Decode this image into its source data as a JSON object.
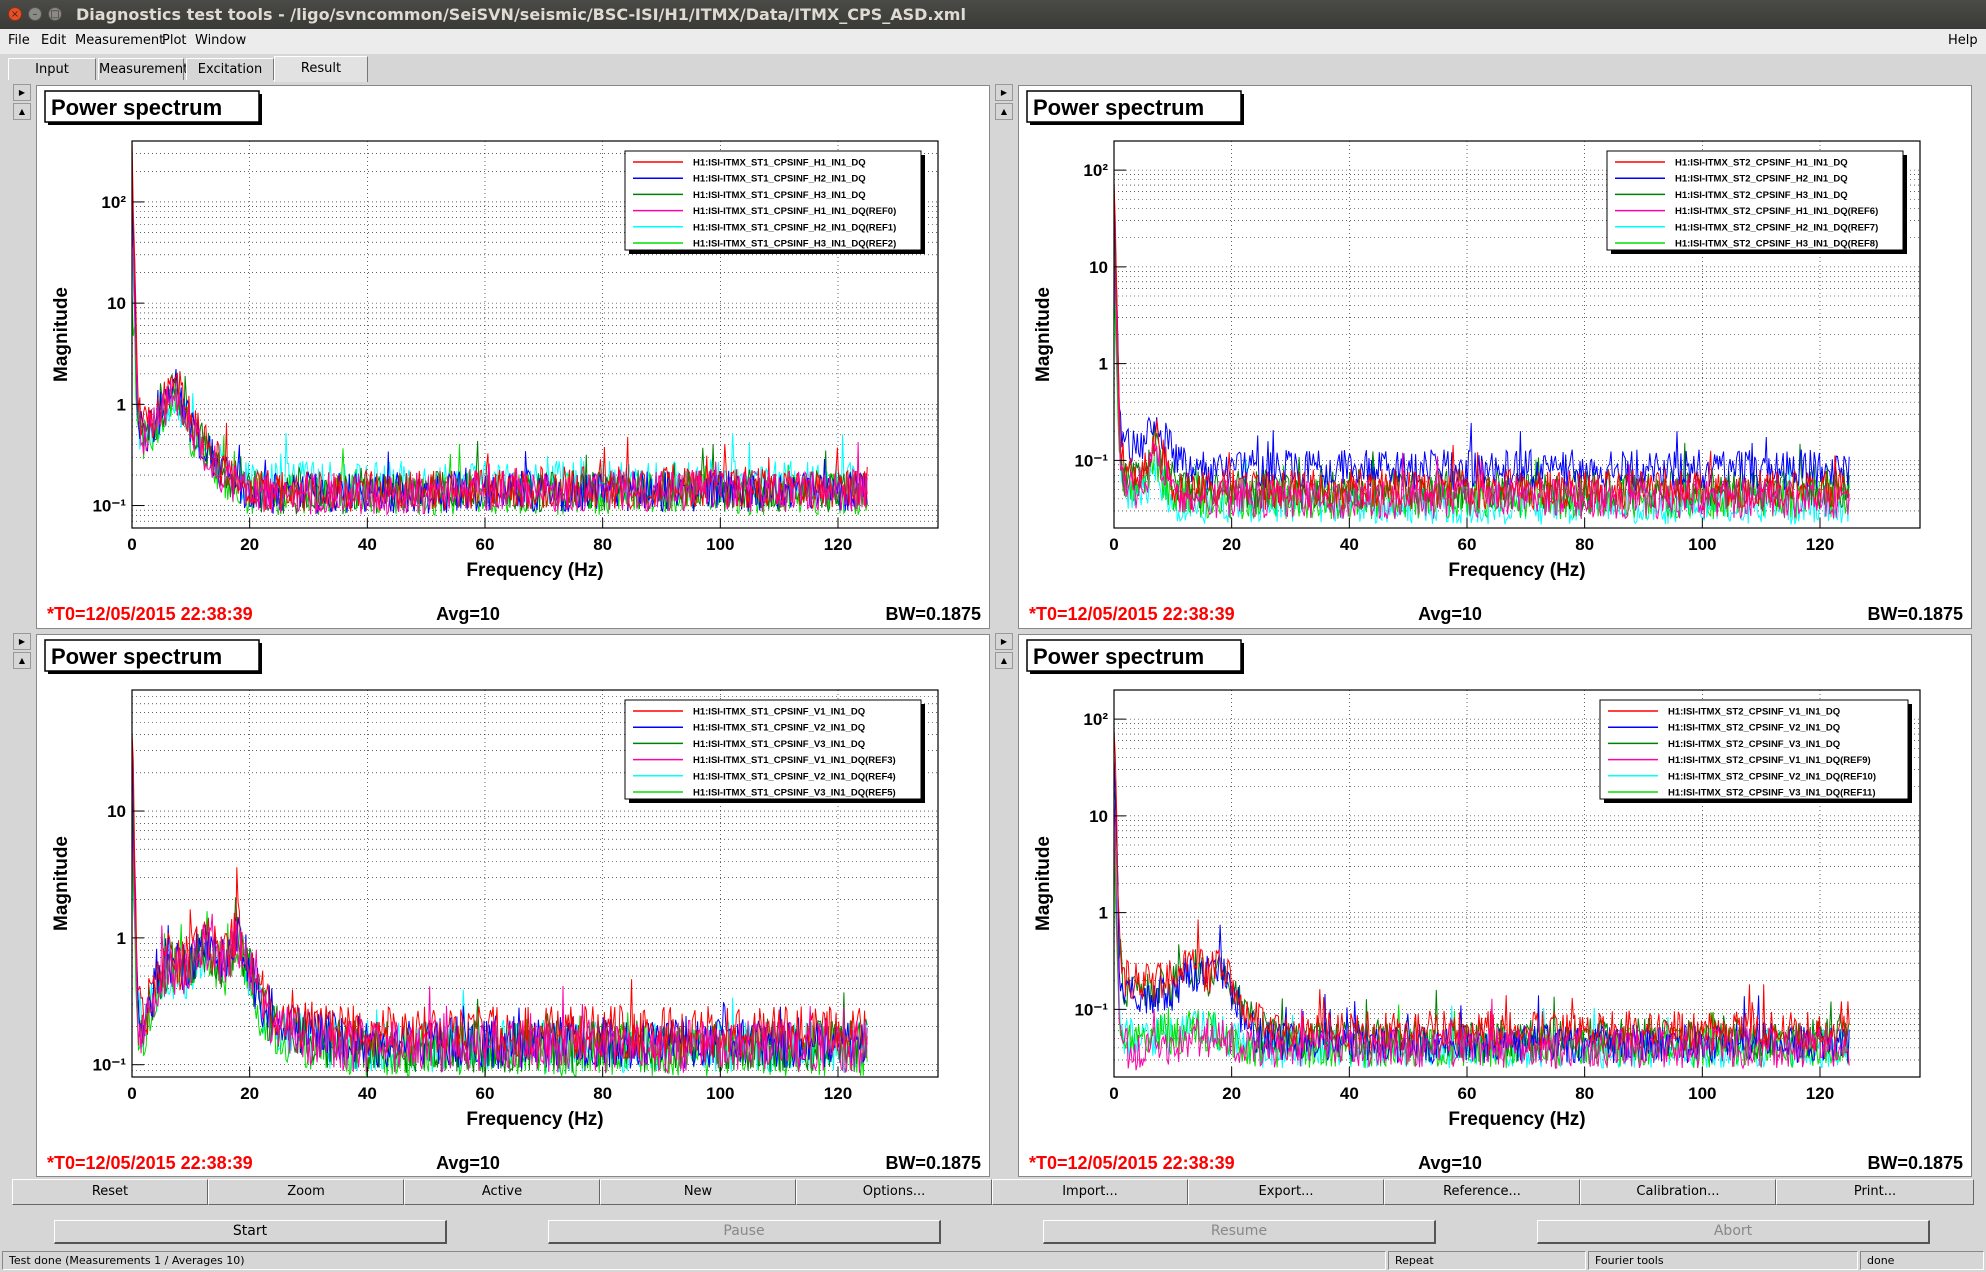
{
  "window": {
    "title": "Diagnostics test tools - /ligo/svncommon/SeiSVN/seismic/BSC-ISI/H1/ITMX/Data/ITMX_CPS_ASD.xml"
  },
  "menu": {
    "items": [
      "File",
      "Edit",
      "Measurement",
      "Plot",
      "Window"
    ],
    "help": "Help"
  },
  "tabs": [
    {
      "label": "Input",
      "active": false
    },
    {
      "label": "Measurement",
      "active": false
    },
    {
      "label": "Excitation",
      "active": false
    },
    {
      "label": "Result",
      "active": true
    }
  ],
  "plots": [
    {
      "title": "Power spectrum",
      "t0": "*T0=12/05/2015 22:38:39",
      "avg": "Avg=10",
      "bw": "BW=0.1875",
      "legend": [
        "H1:ISI-ITMX_ST1_CPSINF_H1_IN1_DQ",
        "H1:ISI-ITMX_ST1_CPSINF_H2_IN1_DQ",
        "H1:ISI-ITMX_ST1_CPSINF_H3_IN1_DQ",
        "H1:ISI-ITMX_ST1_CPSINF_H1_IN1_DQ(REF0)",
        "H1:ISI-ITMX_ST1_CPSINF_H2_IN1_DQ(REF1)",
        "H1:ISI-ITMX_ST1_CPSINF_H3_IN1_DQ(REF2)"
      ],
      "ytick_labels": [
        "10⁻¹",
        "1",
        "10",
        "10²"
      ]
    },
    {
      "title": "Power spectrum",
      "t0": "*T0=12/05/2015 22:38:39",
      "avg": "Avg=10",
      "bw": "BW=0.1875",
      "legend": [
        "H1:ISI-ITMX_ST2_CPSINF_H1_IN1_DQ",
        "H1:ISI-ITMX_ST2_CPSINF_H2_IN1_DQ",
        "H1:ISI-ITMX_ST2_CPSINF_H3_IN1_DQ",
        "H1:ISI-ITMX_ST2_CPSINF_H1_IN1_DQ(REF6)",
        "H1:ISI-ITMX_ST2_CPSINF_H2_IN1_DQ(REF7)",
        "H1:ISI-ITMX_ST2_CPSINF_H3_IN1_DQ(REF8)"
      ],
      "ytick_labels": [
        "10⁻¹",
        "1",
        "10",
        "10²"
      ]
    },
    {
      "title": "Power spectrum",
      "t0": "*T0=12/05/2015 22:38:39",
      "avg": "Avg=10",
      "bw": "BW=0.1875",
      "legend": [
        "H1:ISI-ITMX_ST1_CPSINF_V1_IN1_DQ",
        "H1:ISI-ITMX_ST1_CPSINF_V2_IN1_DQ",
        "H1:ISI-ITMX_ST1_CPSINF_V3_IN1_DQ",
        "H1:ISI-ITMX_ST1_CPSINF_V1_IN1_DQ(REF3)",
        "H1:ISI-ITMX_ST1_CPSINF_V2_IN1_DQ(REF4)",
        "H1:ISI-ITMX_ST1_CPSINF_V3_IN1_DQ(REF5)"
      ],
      "ytick_labels": [
        "10⁻¹",
        "1",
        "10"
      ]
    },
    {
      "title": "Power spectrum",
      "t0": "*T0=12/05/2015 22:38:39",
      "avg": "Avg=10",
      "bw": "BW=0.1875",
      "legend": [
        "H1:ISI-ITMX_ST2_CPSINF_V1_IN1_DQ",
        "H1:ISI-ITMX_ST2_CPSINF_V2_IN1_DQ",
        "H1:ISI-ITMX_ST2_CPSINF_V3_IN1_DQ",
        "H1:ISI-ITMX_ST2_CPSINF_V1_IN1_DQ(REF9)",
        "H1:ISI-ITMX_ST2_CPSINF_V2_IN1_DQ(REF10)",
        "H1:ISI-ITMX_ST2_CPSINF_V3_IN1_DQ(REF11)"
      ],
      "ytick_labels": [
        "10⁻¹",
        "1",
        "10",
        "10²"
      ]
    }
  ],
  "chart_data": [
    {
      "type": "line",
      "title": "Power spectrum",
      "xlabel": "Frequency (Hz)",
      "ylabel": "Magnitude",
      "xlim": [
        0,
        137
      ],
      "ylim": [
        0.06,
        400
      ],
      "yscale": "log",
      "grid": true,
      "legend_position": "top-right",
      "xticks": [
        0,
        20,
        40,
        60,
        80,
        100,
        120
      ],
      "series_colors": [
        "#ff0000",
        "#0000ff",
        "#008000",
        "#ff00aa",
        "#00ffff",
        "#00e000"
      ],
      "x": [
        0,
        1,
        2,
        4,
        6,
        7,
        8,
        10,
        12,
        14,
        16,
        18,
        20,
        25,
        30,
        40,
        60,
        80,
        100,
        120,
        125
      ],
      "series": [
        {
          "name": "H1:ISI-ITMX_ST1_CPSINF_H1_IN1_DQ",
          "values": [
            300,
            0.9,
            0.6,
            0.8,
            1.2,
            2.0,
            1.4,
            0.7,
            0.45,
            0.3,
            0.22,
            0.18,
            0.15,
            0.14,
            0.14,
            0.14,
            0.15,
            0.15,
            0.15,
            0.15,
            0.15
          ]
        },
        {
          "name": "H1:ISI-ITMX_ST1_CPSINF_H2_IN1_DQ",
          "values": [
            200,
            0.8,
            0.5,
            0.7,
            1.1,
            1.8,
            1.3,
            0.6,
            0.4,
            0.28,
            0.2,
            0.17,
            0.14,
            0.13,
            0.13,
            0.13,
            0.14,
            0.14,
            0.14,
            0.14,
            0.14
          ]
        },
        {
          "name": "H1:ISI-ITMX_ST1_CPSINF_H3_IN1_DQ",
          "values": [
            100,
            0.7,
            0.5,
            0.7,
            1.0,
            1.6,
            1.2,
            0.6,
            0.4,
            0.27,
            0.2,
            0.16,
            0.14,
            0.13,
            0.13,
            0.13,
            0.14,
            0.14,
            0.14,
            0.14,
            0.14
          ]
        },
        {
          "name": "H1:ISI-ITMX_ST1_CPSINF_H1_IN1_DQ(REF0)",
          "values": [
            60,
            0.7,
            0.5,
            0.6,
            1.0,
            1.5,
            1.1,
            0.6,
            0.38,
            0.26,
            0.19,
            0.16,
            0.14,
            0.13,
            0.13,
            0.13,
            0.14,
            0.14,
            0.14,
            0.14,
            0.14
          ]
        },
        {
          "name": "H1:ISI-ITMX_ST1_CPSINF_H2_IN1_DQ(REF1)",
          "values": [
            30,
            0.6,
            0.45,
            0.6,
            0.9,
            1.4,
            1.0,
            0.55,
            0.38,
            0.28,
            0.22,
            0.19,
            0.17,
            0.17,
            0.17,
            0.17,
            0.17,
            0.17,
            0.17,
            0.17,
            0.17
          ]
        },
        {
          "name": "H1:ISI-ITMX_ST1_CPSINF_H3_IN1_DQ(REF2)",
          "values": [
            15,
            0.6,
            0.45,
            0.6,
            0.9,
            1.4,
            1.0,
            0.5,
            0.35,
            0.25,
            0.18,
            0.15,
            0.13,
            0.13,
            0.13,
            0.13,
            0.13,
            0.13,
            0.13,
            0.13,
            0.13
          ]
        }
      ]
    },
    {
      "type": "line",
      "title": "Power spectrum",
      "xlabel": "Frequency (Hz)",
      "ylabel": "Magnitude",
      "xlim": [
        0,
        137
      ],
      "ylim": [
        0.02,
        200
      ],
      "yscale": "log",
      "grid": true,
      "legend_position": "top-right",
      "xticks": [
        0,
        20,
        40,
        60,
        80,
        100,
        120
      ],
      "series_colors": [
        "#ff0000",
        "#0000ff",
        "#008000",
        "#ff00aa",
        "#00ffff",
        "#00e000"
      ],
      "x": [
        0,
        1,
        2,
        4,
        6,
        7,
        8,
        10,
        12,
        14,
        16,
        18,
        20,
        25,
        30,
        40,
        60,
        80,
        100,
        120,
        125
      ],
      "series": [
        {
          "name": "H1:ISI-ITMX_ST2_CPSINF_H1_IN1_DQ",
          "values": [
            120,
            0.12,
            0.08,
            0.06,
            0.1,
            0.2,
            0.12,
            0.06,
            0.05,
            0.05,
            0.05,
            0.05,
            0.05,
            0.05,
            0.05,
            0.05,
            0.05,
            0.05,
            0.05,
            0.05,
            0.05
          ]
        },
        {
          "name": "H1:ISI-ITMX_ST2_CPSINF_H2_IN1_DQ",
          "values": [
            80,
            0.2,
            0.14,
            0.12,
            0.18,
            0.3,
            0.2,
            0.11,
            0.09,
            0.085,
            0.08,
            0.08,
            0.08,
            0.08,
            0.08,
            0.08,
            0.08,
            0.08,
            0.08,
            0.08,
            0.08
          ]
        },
        {
          "name": "H1:ISI-ITMX_ST2_CPSINF_H3_IN1_DQ",
          "values": [
            40,
            0.1,
            0.07,
            0.06,
            0.1,
            0.18,
            0.1,
            0.06,
            0.05,
            0.05,
            0.05,
            0.05,
            0.05,
            0.05,
            0.05,
            0.05,
            0.05,
            0.05,
            0.05,
            0.05,
            0.05
          ]
        },
        {
          "name": "H1:ISI-ITMX_ST2_CPSINF_H1_IN1_DQ(REF6)",
          "values": [
            20,
            0.1,
            0.06,
            0.05,
            0.08,
            0.14,
            0.08,
            0.05,
            0.04,
            0.04,
            0.04,
            0.04,
            0.04,
            0.04,
            0.04,
            0.04,
            0.04,
            0.04,
            0.04,
            0.04,
            0.04
          ]
        },
        {
          "name": "H1:ISI-ITMX_ST2_CPSINF_H2_IN1_DQ(REF7)",
          "values": [
            10,
            0.09,
            0.05,
            0.04,
            0.06,
            0.1,
            0.06,
            0.04,
            0.035,
            0.035,
            0.035,
            0.035,
            0.035,
            0.035,
            0.035,
            0.035,
            0.035,
            0.035,
            0.035,
            0.035,
            0.035
          ]
        },
        {
          "name": "H1:ISI-ITMX_ST2_CPSINF_H3_IN1_DQ(REF8)",
          "values": [
            8,
            0.09,
            0.06,
            0.05,
            0.07,
            0.12,
            0.07,
            0.045,
            0.04,
            0.04,
            0.04,
            0.04,
            0.04,
            0.04,
            0.04,
            0.04,
            0.04,
            0.04,
            0.04,
            0.04,
            0.04
          ]
        }
      ]
    },
    {
      "type": "line",
      "title": "Power spectrum",
      "xlabel": "Frequency (Hz)",
      "ylabel": "Magnitude",
      "xlim": [
        0,
        137
      ],
      "ylim": [
        0.08,
        90
      ],
      "yscale": "log",
      "grid": true,
      "legend_position": "top-right",
      "xticks": [
        0,
        20,
        40,
        60,
        80,
        100,
        120
      ],
      "series_colors": [
        "#ff0000",
        "#0000ff",
        "#008000",
        "#ff00aa",
        "#00ffff",
        "#00e000"
      ],
      "x": [
        0,
        1,
        2,
        4,
        6,
        8,
        10,
        12,
        14,
        16,
        18,
        20,
        22,
        25,
        30,
        40,
        60,
        80,
        100,
        120,
        125
      ],
      "series": [
        {
          "name": "H1:ISI-ITMX_ST1_CPSINF_V1_IN1_DQ",
          "values": [
            60,
            0.3,
            0.2,
            0.5,
            0.7,
            0.6,
            0.7,
            1.0,
            0.8,
            0.7,
            1.2,
            0.7,
            0.35,
            0.25,
            0.2,
            0.18,
            0.18,
            0.18,
            0.18,
            0.18,
            0.18
          ]
        },
        {
          "name": "H1:ISI-ITMX_ST1_CPSINF_V2_IN1_DQ",
          "values": [
            40,
            0.25,
            0.18,
            0.45,
            0.65,
            0.55,
            0.65,
            0.9,
            0.75,
            0.65,
            1.1,
            0.6,
            0.3,
            0.22,
            0.17,
            0.15,
            0.15,
            0.15,
            0.15,
            0.15,
            0.15
          ]
        },
        {
          "name": "H1:ISI-ITMX_ST1_CPSINF_V3_IN1_DQ",
          "values": [
            20,
            0.25,
            0.18,
            0.45,
            0.6,
            0.55,
            0.6,
            0.9,
            0.7,
            0.6,
            1.0,
            0.55,
            0.28,
            0.2,
            0.15,
            0.14,
            0.14,
            0.14,
            0.14,
            0.14,
            0.14
          ]
        },
        {
          "name": "H1:ISI-ITMX_ST1_CPSINF_V1_IN1_DQ(REF3)",
          "values": [
            10,
            0.22,
            0.17,
            0.42,
            0.6,
            0.5,
            0.6,
            0.85,
            0.7,
            0.6,
            1.0,
            0.55,
            0.27,
            0.2,
            0.15,
            0.14,
            0.14,
            0.14,
            0.14,
            0.14,
            0.14
          ]
        },
        {
          "name": "H1:ISI-ITMX_ST1_CPSINF_V2_IN1_DQ(REF4)",
          "values": [
            6,
            0.2,
            0.16,
            0.4,
            0.55,
            0.5,
            0.55,
            0.8,
            0.65,
            0.55,
            0.95,
            0.5,
            0.26,
            0.19,
            0.15,
            0.14,
            0.14,
            0.14,
            0.14,
            0.14,
            0.14
          ]
        },
        {
          "name": "H1:ISI-ITMX_ST1_CPSINF_V3_IN1_DQ(REF5)",
          "values": [
            4,
            0.2,
            0.16,
            0.4,
            0.55,
            0.5,
            0.55,
            0.8,
            0.65,
            0.55,
            0.95,
            0.5,
            0.25,
            0.18,
            0.14,
            0.13,
            0.13,
            0.13,
            0.13,
            0.13,
            0.13
          ]
        }
      ]
    },
    {
      "type": "line",
      "title": "Power spectrum",
      "xlabel": "Frequency (Hz)",
      "ylabel": "Magnitude",
      "xlim": [
        0,
        137
      ],
      "ylim": [
        0.02,
        200
      ],
      "yscale": "log",
      "grid": true,
      "legend_position": "top-right",
      "xticks": [
        0,
        20,
        40,
        60,
        80,
        100,
        120
      ],
      "series_colors": [
        "#ff0000",
        "#0000ff",
        "#008000",
        "#ff00aa",
        "#00ffff",
        "#00e000"
      ],
      "x": [
        0,
        1,
        2,
        4,
        6,
        8,
        10,
        12,
        14,
        16,
        18,
        20,
        22,
        25,
        30,
        40,
        60,
        80,
        100,
        120,
        125
      ],
      "series": [
        {
          "name": "H1:ISI-ITMX_ST2_CPSINF_V1_IN1_DQ",
          "values": [
            100,
            0.25,
            0.2,
            0.2,
            0.18,
            0.2,
            0.2,
            0.28,
            0.3,
            0.22,
            0.35,
            0.2,
            0.1,
            0.07,
            0.06,
            0.06,
            0.06,
            0.06,
            0.06,
            0.06,
            0.06
          ]
        },
        {
          "name": "H1:ISI-ITMX_ST2_CPSINF_V2_IN1_DQ",
          "values": [
            60,
            0.2,
            0.15,
            0.14,
            0.13,
            0.15,
            0.15,
            0.22,
            0.25,
            0.18,
            0.3,
            0.15,
            0.08,
            0.05,
            0.045,
            0.045,
            0.045,
            0.045,
            0.045,
            0.045,
            0.045
          ]
        },
        {
          "name": "H1:ISI-ITMX_ST2_CPSINF_V3_IN1_DQ",
          "values": [
            30,
            0.22,
            0.17,
            0.17,
            0.15,
            0.17,
            0.17,
            0.25,
            0.27,
            0.2,
            0.32,
            0.17,
            0.09,
            0.06,
            0.05,
            0.05,
            0.05,
            0.05,
            0.05,
            0.05,
            0.05
          ]
        },
        {
          "name": "H1:ISI-ITMX_ST2_CPSINF_V1_IN1_DQ(REF9)",
          "values": [
            20,
            0.05,
            0.04,
            0.035,
            0.04,
            0.04,
            0.04,
            0.05,
            0.05,
            0.05,
            0.05,
            0.045,
            0.04,
            0.04,
            0.04,
            0.04,
            0.04,
            0.04,
            0.04,
            0.04,
            0.04
          ]
        },
        {
          "name": "H1:ISI-ITMX_ST2_CPSINF_V2_IN1_DQ(REF10)",
          "values": [
            10,
            0.06,
            0.05,
            0.05,
            0.05,
            0.06,
            0.05,
            0.06,
            0.06,
            0.06,
            0.06,
            0.05,
            0.045,
            0.04,
            0.04,
            0.04,
            0.04,
            0.04,
            0.04,
            0.04,
            0.04
          ]
        },
        {
          "name": "H1:ISI-ITMX_ST2_CPSINF_V3_IN1_DQ(REF11)",
          "values": [
            6,
            0.06,
            0.05,
            0.05,
            0.05,
            0.06,
            0.05,
            0.06,
            0.06,
            0.06,
            0.06,
            0.05,
            0.045,
            0.04,
            0.04,
            0.04,
            0.04,
            0.04,
            0.04,
            0.04,
            0.04
          ]
        }
      ]
    }
  ],
  "toolbar": [
    "Reset",
    "Zoom",
    "Active",
    "New",
    "Options...",
    "Import...",
    "Export...",
    "Reference...",
    "Calibration...",
    "Print..."
  ],
  "controls": [
    {
      "label": "Start",
      "enabled": true
    },
    {
      "label": "Pause",
      "enabled": false
    },
    {
      "label": "Resume",
      "enabled": false
    },
    {
      "label": "Abort",
      "enabled": false
    }
  ],
  "status": {
    "message": "Test done (Measurements 1 / Averages 10)",
    "mode": "Repeat",
    "tool": "Fourier tools",
    "state": "done"
  }
}
